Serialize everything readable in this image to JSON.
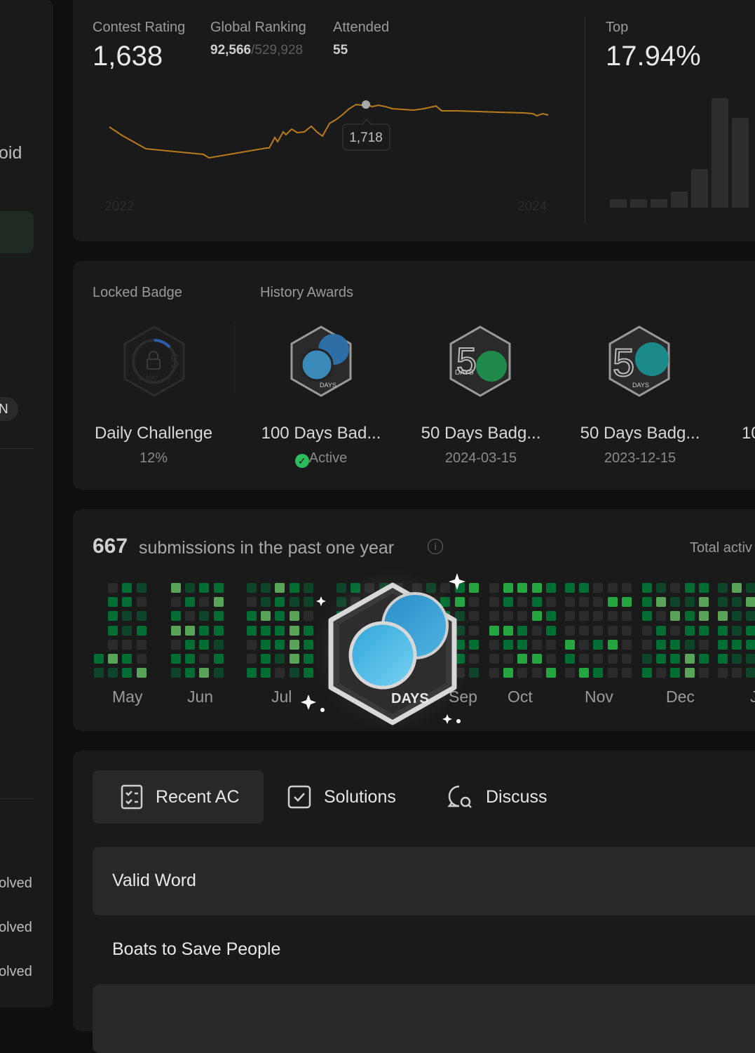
{
  "left_panel": {
    "fragment_top": "oid",
    "fragment_badge": "N",
    "solved_items": [
      "olved",
      "olved",
      "olved"
    ]
  },
  "contest": {
    "rating_label": "Contest Rating",
    "rating_value": "1,638",
    "ranking_label": "Global Ranking",
    "ranking_value": "92,566",
    "ranking_total": "/529,928",
    "attended_label": "Attended",
    "attended_value": "55",
    "top_label": "Top",
    "top_value": "17.94%",
    "tooltip_value": "1,718",
    "year_start": "2022",
    "year_end": "2024",
    "line_color": "#b87b1e",
    "distribution_bar_heights": [
      0.08,
      0.08,
      0.08,
      0.15,
      0.35,
      1.0,
      0.82
    ]
  },
  "badges": {
    "locked_label": "Locked Badge",
    "history_label": "History Awards",
    "locked": {
      "title": "Daily Challenge",
      "progress": "12%"
    },
    "awards": [
      {
        "title": "100 Days Bad...",
        "status": "Active"
      },
      {
        "title": "50 Days Badg...",
        "date": "2024-03-15"
      },
      {
        "title": "50 Days Badg...",
        "date": "2023-12-15"
      },
      {
        "title": "10"
      }
    ],
    "badge_word": "DAYS",
    "locked_badge_text": "MAY"
  },
  "submissions": {
    "count": "667",
    "label": "submissions in the past one year",
    "info_icon": "info-icon",
    "total_label": "Total activ",
    "months": [
      "May",
      "Jun",
      "Jul",
      "Sep",
      "Oct",
      "Nov",
      "Dec",
      "J"
    ],
    "colors": {
      "empty": "#2b2b2b",
      "l1": "#0e4429",
      "l2": "#006d32",
      "l3": "#26a641",
      "l4": "#5aa45a"
    },
    "popup_badge_word": "DAYS"
  },
  "tabs": [
    {
      "label": "Recent AC",
      "icon": "checklist-icon"
    },
    {
      "label": "Solutions",
      "icon": "checkbox-icon"
    },
    {
      "label": "Discuss",
      "icon": "chat-search-icon"
    }
  ],
  "recent": [
    "Valid Word",
    "Boats to Save People",
    ""
  ]
}
